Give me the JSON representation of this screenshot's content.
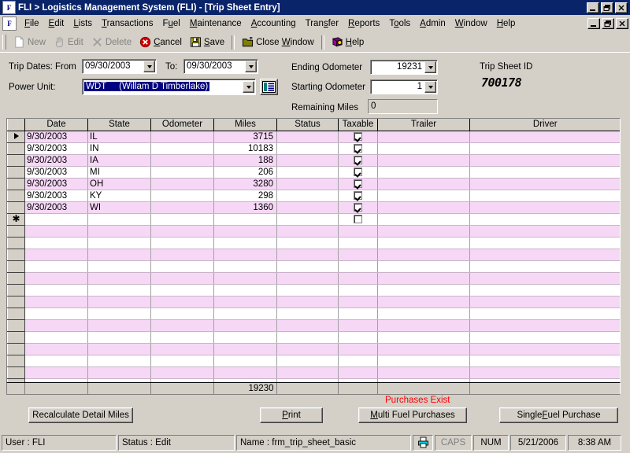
{
  "window": {
    "title": "FLI > Logistics Management System (FLI) - [Trip Sheet Entry]",
    "app_icon": "F",
    "mdi_icon": "F",
    "minimize": "minimize-icon",
    "restore": "restore-icon",
    "close": "close-icon"
  },
  "menu": {
    "items": [
      {
        "label": "File",
        "accel": "F"
      },
      {
        "label": "Edit",
        "accel": "E"
      },
      {
        "label": "Lists",
        "accel": "L"
      },
      {
        "label": "Transactions",
        "accel": "T"
      },
      {
        "label": "Fuel",
        "accel": "u"
      },
      {
        "label": "Maintenance",
        "accel": "M"
      },
      {
        "label": "Accounting",
        "accel": "A"
      },
      {
        "label": "Transfer",
        "accel": "s"
      },
      {
        "label": "Reports",
        "accel": "R"
      },
      {
        "label": "Tools",
        "accel": "o"
      },
      {
        "label": "Admin",
        "accel": "A"
      },
      {
        "label": "Window",
        "accel": "W"
      },
      {
        "label": "Help",
        "accel": "H"
      }
    ]
  },
  "toolbar": {
    "new": {
      "label": "New",
      "icon": "page-icon",
      "enabled": false
    },
    "edit": {
      "label": "Edit",
      "icon": "hand-pointer-icon",
      "enabled": false
    },
    "delete": {
      "label": "Delete",
      "icon": "x-mark-icon",
      "enabled": false
    },
    "cancel": {
      "label": "Cancel",
      "icon": "cancel-circle-icon",
      "enabled": true
    },
    "save": {
      "label": "Save",
      "icon": "floppy-disk-icon",
      "enabled": true
    },
    "close_window": {
      "label": "Close Window",
      "icon": "folder-icon",
      "enabled": true
    },
    "help": {
      "label": "Help",
      "icon": "help-book-icon",
      "enabled": true
    }
  },
  "form": {
    "trip_dates_label": "Trip Dates: From",
    "trip_date_from": "09/30/2003",
    "to_label": "To:",
    "trip_date_to": "09/30/2003",
    "power_unit_label": "Power Unit:",
    "power_unit_code": "WDT",
    "power_unit_name": "(Willam D Timberlake)",
    "lookup_icon": "list-lookup-icon",
    "ending_odometer_label": "Ending Odometer",
    "ending_odometer": "19231",
    "starting_odometer_label": "Starting Odometer",
    "starting_odometer": "1",
    "remaining_miles_label": "Remaining Miles",
    "remaining_miles": "0",
    "trip_sheet_id_label": "Trip Sheet ID",
    "trip_sheet_id": "700178"
  },
  "grid": {
    "columns": [
      "",
      "Date",
      "State",
      "Odometer",
      "Miles",
      "Status",
      "Taxable",
      "Trailer",
      "Driver"
    ],
    "rows": [
      {
        "marker": "current",
        "date": "9/30/2003",
        "state": "IL",
        "odometer": "",
        "miles": "3715",
        "status": "",
        "taxable": true,
        "trailer": "",
        "driver": ""
      },
      {
        "marker": "",
        "date": "9/30/2003",
        "state": "IN",
        "odometer": "",
        "miles": "10183",
        "status": "",
        "taxable": true,
        "trailer": "",
        "driver": ""
      },
      {
        "marker": "",
        "date": "9/30/2003",
        "state": "IA",
        "odometer": "",
        "miles": "188",
        "status": "",
        "taxable": true,
        "trailer": "",
        "driver": ""
      },
      {
        "marker": "",
        "date": "9/30/2003",
        "state": "MI",
        "odometer": "",
        "miles": "206",
        "status": "",
        "taxable": true,
        "trailer": "",
        "driver": ""
      },
      {
        "marker": "",
        "date": "9/30/2003",
        "state": "OH",
        "odometer": "",
        "miles": "3280",
        "status": "",
        "taxable": true,
        "trailer": "",
        "driver": ""
      },
      {
        "marker": "",
        "date": "9/30/2003",
        "state": "KY",
        "odometer": "",
        "miles": "298",
        "status": "",
        "taxable": true,
        "trailer": "",
        "driver": ""
      },
      {
        "marker": "",
        "date": "9/30/2003",
        "state": "WI",
        "odometer": "",
        "miles": "1360",
        "status": "",
        "taxable": true,
        "trailer": "",
        "driver": ""
      },
      {
        "marker": "new",
        "date": "",
        "state": "",
        "odometer": "",
        "miles": "",
        "status": "",
        "taxable": false,
        "trailer": "",
        "driver": ""
      }
    ],
    "blank_row_count": 14,
    "total_miles": "19230",
    "row_colors": {
      "odd": "#f6d8f6",
      "even": "#ffffff",
      "header": "#d4d0c8"
    }
  },
  "footer": {
    "purchases_note": "Purchases Exist",
    "purchases_note_color": "#ff0000",
    "recalculate_button": "Recalculate Detail Miles",
    "print_button": "Print",
    "multi_fuel_button": "Multi Fuel Purchases",
    "single_fuel_button": "Single Fuel  Purchase"
  },
  "statusbar": {
    "user": "User : FLI",
    "status": "Status : Edit",
    "name": "Name : frm_trip_sheet_basic",
    "printer_icon": "printer-icon",
    "caps": "CAPS",
    "num": "NUM",
    "date": "5/21/2006",
    "time": "8:38 AM"
  }
}
